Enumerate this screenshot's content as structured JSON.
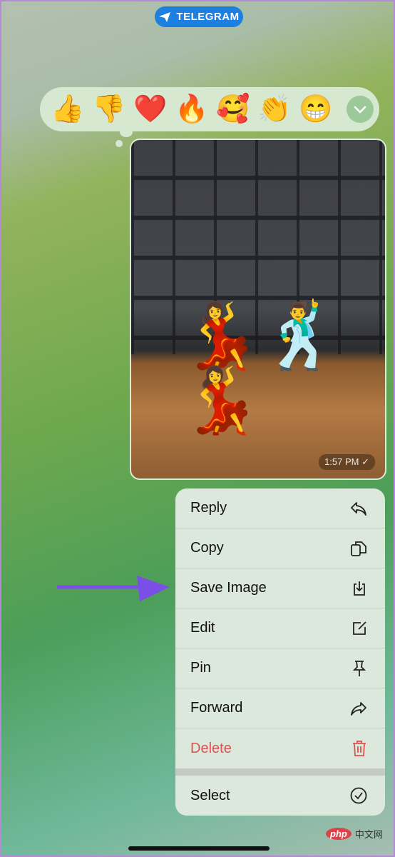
{
  "header": {
    "badge": "TELEGRAM"
  },
  "reactions": [
    {
      "name": "thumbs-up",
      "glyph": "👍"
    },
    {
      "name": "thumbs-down",
      "glyph": "👎"
    },
    {
      "name": "heart",
      "glyph": "❤️"
    },
    {
      "name": "fire",
      "glyph": "🔥"
    },
    {
      "name": "smiling-face-with-hearts",
      "glyph": "🥰"
    },
    {
      "name": "clapping-hands",
      "glyph": "👏"
    },
    {
      "name": "grinning-face",
      "glyph": "😁"
    }
  ],
  "message": {
    "time": "1:57 PM",
    "status": "read-check"
  },
  "menu": {
    "items": [
      {
        "label": "Reply",
        "icon": "reply-icon"
      },
      {
        "label": "Copy",
        "icon": "copy-icon"
      },
      {
        "label": "Save Image",
        "icon": "save-icon"
      },
      {
        "label": "Edit",
        "icon": "edit-icon"
      },
      {
        "label": "Pin",
        "icon": "pin-icon"
      },
      {
        "label": "Forward",
        "icon": "forward-icon"
      },
      {
        "label": "Delete",
        "icon": "trash-icon"
      }
    ],
    "select": {
      "label": "Select",
      "icon": "check-circle-icon"
    }
  },
  "colors": {
    "accent": "#1d7fe0",
    "delete": "#e05050",
    "arrow": "#7b4fe6"
  },
  "watermark": {
    "logo": "php",
    "text": "中文网"
  }
}
